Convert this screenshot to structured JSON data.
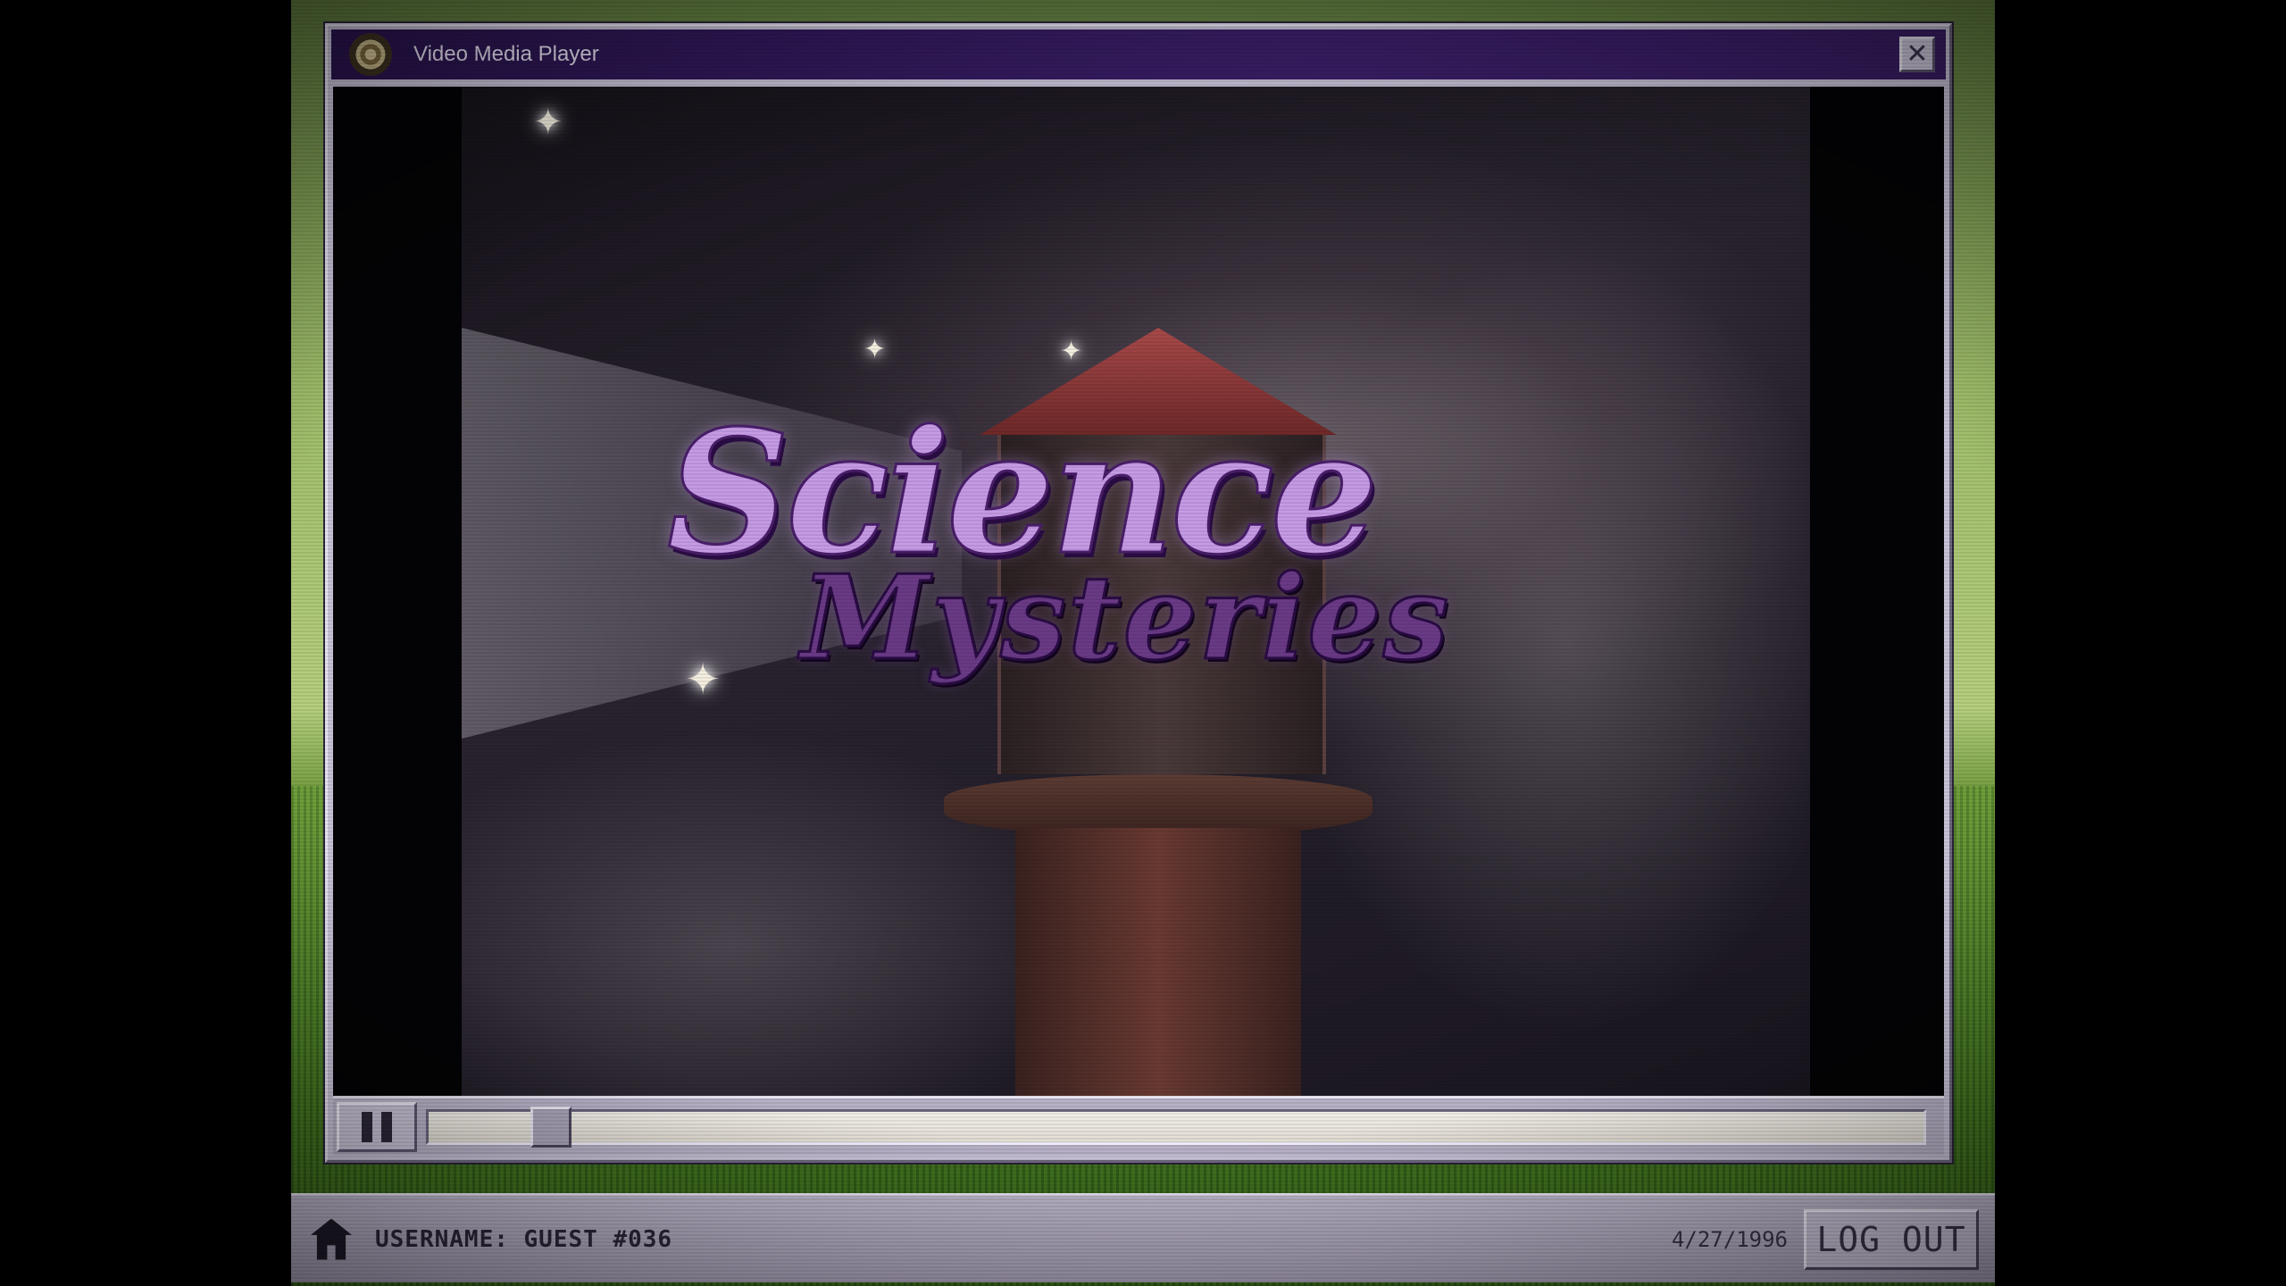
{
  "window": {
    "title": "Video Media Player",
    "close_symbol": "✕"
  },
  "video": {
    "title_line1": "Science",
    "title_line2": "Mysteries",
    "progress_fraction": 0.07
  },
  "taskbar": {
    "username": "USERNAME: GUEST #036",
    "date": "4/27/1996",
    "logout_label": "LOG OUT"
  },
  "icons": {
    "app": "film-reel-icon",
    "close": "close-icon",
    "pause": "pause-icon",
    "user": "house-user-icon"
  }
}
